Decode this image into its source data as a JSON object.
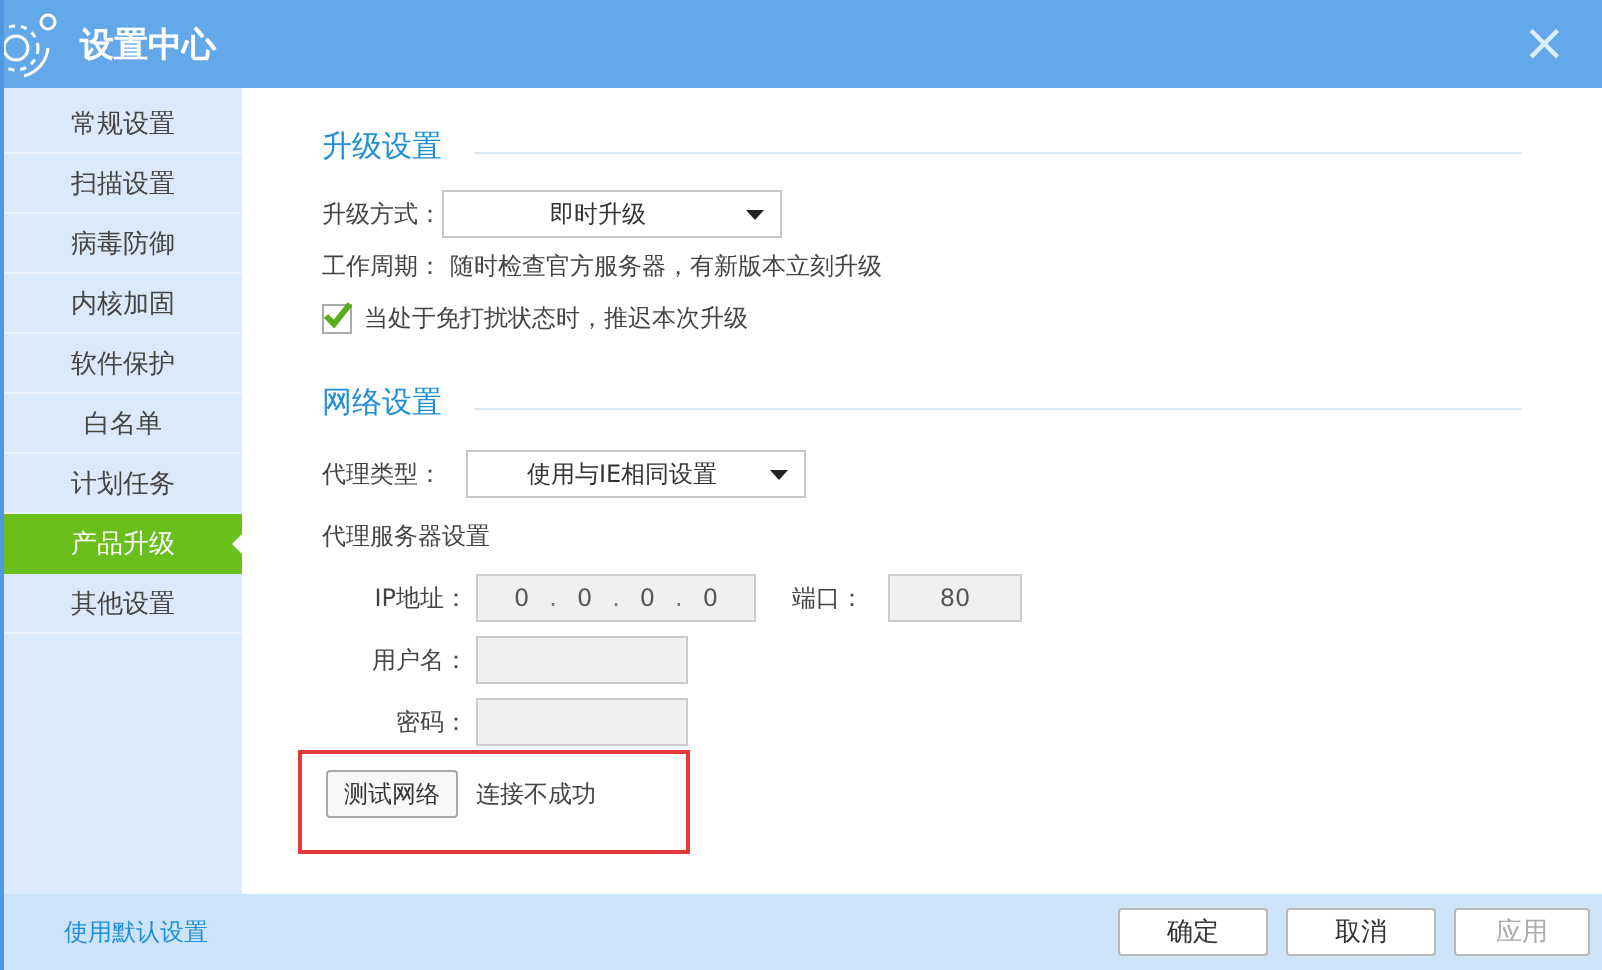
{
  "window": {
    "title": "设置中心",
    "close": "×"
  },
  "sidebar": {
    "items": [
      {
        "label": "常规设置",
        "selected": false
      },
      {
        "label": "扫描设置",
        "selected": false
      },
      {
        "label": "病毒防御",
        "selected": false
      },
      {
        "label": "内核加固",
        "selected": false
      },
      {
        "label": "软件保护",
        "selected": false
      },
      {
        "label": "白名单",
        "selected": false
      },
      {
        "label": "计划任务",
        "selected": false
      },
      {
        "label": "产品升级",
        "selected": true
      },
      {
        "label": "其他设置",
        "selected": false
      }
    ]
  },
  "upgrade": {
    "title": "升级设置",
    "mode_label": "升级方式：",
    "mode_value": "即时升级",
    "cycle_label": "工作周期：",
    "cycle_text": "随时检查官方服务器，有新版本立刻升级",
    "defer": {
      "label": "当处于免打扰状态时，推迟本次升级",
      "checked": true
    }
  },
  "network": {
    "title": "网络设置",
    "proxy_type_label": "代理类型：",
    "proxy_type_value": "使用与IE相同设置",
    "proxy_server_label": "代理服务器设置",
    "ip_label": "IP地址：",
    "ip_parts": [
      "0",
      "0",
      "0",
      "0"
    ],
    "ip_separator": ".",
    "port_label": "端口：",
    "port_value": "80",
    "username_label": "用户名：",
    "password_label": "密码：",
    "test_button": "测试网络",
    "test_status": "连接不成功",
    "highlight": true
  },
  "footer": {
    "default_link": "使用默认设置",
    "buttons": [
      {
        "label": "确定",
        "disabled": false
      },
      {
        "label": "取消",
        "disabled": false
      },
      {
        "label": "应用",
        "disabled": true
      }
    ]
  }
}
